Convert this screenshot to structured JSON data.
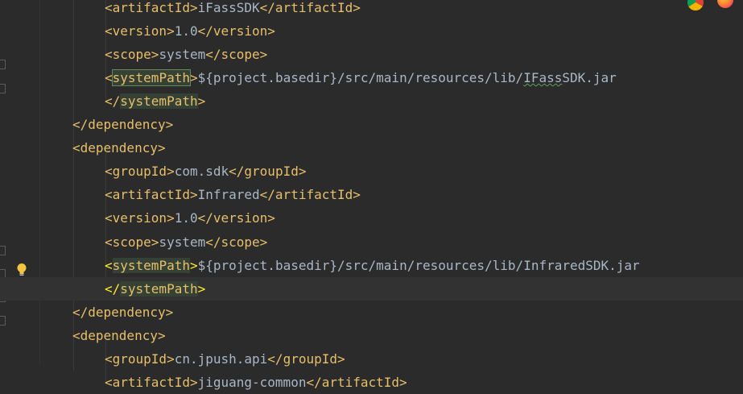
{
  "lines": [
    {
      "id": "l0",
      "indent": 2,
      "parts": [
        {
          "c": "t",
          "v": "<artifactId>"
        },
        {
          "c": "tx",
          "v": "iFassSDK"
        },
        {
          "c": "t",
          "v": "</artifactId>"
        }
      ]
    },
    {
      "id": "l1",
      "indent": 2,
      "parts": [
        {
          "c": "t",
          "v": "<version>"
        },
        {
          "c": "tx",
          "v": "1.0"
        },
        {
          "c": "t",
          "v": "</version>"
        }
      ]
    },
    {
      "id": "l2",
      "indent": 2,
      "parts": [
        {
          "c": "t",
          "v": "<scope>"
        },
        {
          "c": "tx",
          "v": "system"
        },
        {
          "c": "t",
          "v": "</scope>"
        }
      ]
    },
    {
      "id": "l3",
      "indent": 2,
      "parts": [
        {
          "c": "t",
          "v": "<"
        },
        {
          "c": "t hl-box",
          "v": "systemPath"
        },
        {
          "c": "t",
          "v": ">"
        },
        {
          "c": "tx",
          "v": "${project.basedir}/src/main/resources/lib/"
        },
        {
          "c": "tx squig",
          "v": "IFass"
        },
        {
          "c": "tx",
          "v": "SDK.jar"
        }
      ]
    },
    {
      "id": "l4",
      "indent": 2,
      "parts": [
        {
          "c": "t",
          "v": "</"
        },
        {
          "c": "t hl",
          "v": "systemPath"
        },
        {
          "c": "t",
          "v": ">"
        }
      ]
    },
    {
      "id": "l5",
      "indent": 1,
      "parts": [
        {
          "c": "t",
          "v": "</dependency>"
        }
      ]
    },
    {
      "id": "l6",
      "indent": 1,
      "parts": [
        {
          "c": "t",
          "v": "<dependency>"
        }
      ]
    },
    {
      "id": "l7",
      "indent": 2,
      "parts": [
        {
          "c": "t",
          "v": "<groupId>"
        },
        {
          "c": "tx",
          "v": "com.sdk"
        },
        {
          "c": "t",
          "v": "</groupId>"
        }
      ]
    },
    {
      "id": "l8",
      "indent": 2,
      "parts": [
        {
          "c": "t",
          "v": "<artifactId>"
        },
        {
          "c": "tx",
          "v": "Infrared"
        },
        {
          "c": "t",
          "v": "</artifactId>"
        }
      ]
    },
    {
      "id": "l9",
      "indent": 2,
      "parts": [
        {
          "c": "t",
          "v": "<version>"
        },
        {
          "c": "tx",
          "v": "1.0"
        },
        {
          "c": "t",
          "v": "</version>"
        }
      ]
    },
    {
      "id": "l10",
      "indent": 2,
      "parts": [
        {
          "c": "t",
          "v": "<scope>"
        },
        {
          "c": "tx",
          "v": "system"
        },
        {
          "c": "t",
          "v": "</scope>"
        }
      ]
    },
    {
      "id": "l11",
      "indent": 2,
      "parts": [
        {
          "c": "tag-yellow",
          "v": "<"
        },
        {
          "c": "t hl",
          "v": "systemPath"
        },
        {
          "c": "tag-yellow",
          "v": ">"
        },
        {
          "c": "tx",
          "v": "${project.basedir}/src/main/resources/lib/InfraredSDK.jar"
        }
      ]
    },
    {
      "id": "l12",
      "indent": 2,
      "current": true,
      "parts": [
        {
          "c": "tag-yellow",
          "v": "</"
        },
        {
          "c": "t hl",
          "v": "systemPath"
        },
        {
          "c": "tag-yellow",
          "v": ">"
        }
      ]
    },
    {
      "id": "l13",
      "indent": 1,
      "parts": [
        {
          "c": "t",
          "v": "</dependency>"
        }
      ]
    },
    {
      "id": "l14",
      "indent": 1,
      "parts": [
        {
          "c": "t",
          "v": "<dependency>"
        }
      ]
    },
    {
      "id": "l15",
      "indent": 2,
      "parts": [
        {
          "c": "t",
          "v": "<groupId>"
        },
        {
          "c": "tx",
          "v": "cn.jpush.api"
        },
        {
          "c": "t",
          "v": "</groupId>"
        }
      ]
    },
    {
      "id": "l16",
      "indent": 2,
      "parts": [
        {
          "c": "t",
          "v": "<artifactId>"
        },
        {
          "c": "tx",
          "v": "jiguang-common"
        },
        {
          "c": "t",
          "v": "</artifactId>"
        }
      ]
    }
  ],
  "colors": {
    "background": "#2b2b2b",
    "tag": "#e8bf6a",
    "text": "#a9b7c6",
    "match_highlight": "#344134",
    "caret_tag": "#ffef28"
  },
  "icons": {
    "intention": "lightbulb-icon",
    "browsers": [
      "chrome-icon",
      "firefox-icon"
    ]
  }
}
